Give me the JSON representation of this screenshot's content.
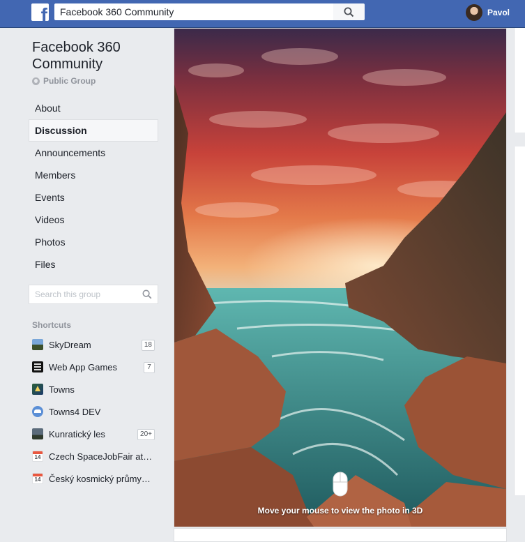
{
  "topbar": {
    "logo": "f",
    "search_value": "Facebook 360 Community",
    "search_icon": "magnifier-icon",
    "user_name": "Pavol"
  },
  "group": {
    "title": "Facebook 360 Community",
    "privacy": "Public Group"
  },
  "nav": [
    {
      "label": "About",
      "active": false
    },
    {
      "label": "Discussion",
      "active": true
    },
    {
      "label": "Announcements",
      "active": false
    },
    {
      "label": "Members",
      "active": false
    },
    {
      "label": "Events",
      "active": false
    },
    {
      "label": "Videos",
      "active": false
    },
    {
      "label": "Photos",
      "active": false
    },
    {
      "label": "Files",
      "active": false
    }
  ],
  "group_search": {
    "placeholder": "Search this group"
  },
  "shortcuts": {
    "title": "Shortcuts",
    "items": [
      {
        "label": "SkyDream",
        "badge": "18",
        "icon": "skydream-icon"
      },
      {
        "label": "Web App Games",
        "badge": "7",
        "icon": "web-app-games-icon"
      },
      {
        "label": "Towns",
        "badge": "",
        "icon": "towns-icon"
      },
      {
        "label": "Towns4 DEV",
        "badge": "",
        "icon": "group-icon"
      },
      {
        "label": "Kunratický les",
        "badge": "20+",
        "icon": "kunraticky-icon"
      },
      {
        "label": "Czech SpaceJobFair at…",
        "badge": "",
        "icon": "calendar-icon",
        "day": "14"
      },
      {
        "label": "Český kosmický průmy…",
        "badge": "",
        "icon": "calendar-icon",
        "day": "14"
      }
    ]
  },
  "photo": {
    "hint": "Move your mouse to view the photo in 3D"
  },
  "colors": {
    "brand": "#4267b2",
    "background": "#e9ebee",
    "muted": "#90949c"
  }
}
